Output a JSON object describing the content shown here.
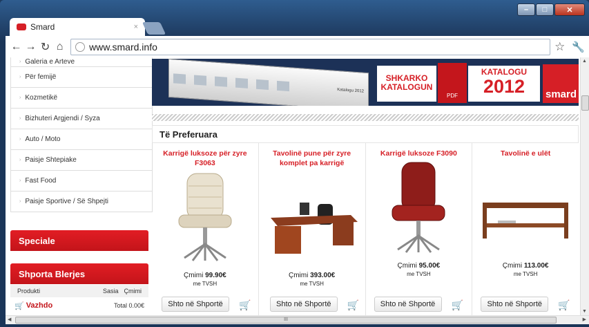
{
  "browser": {
    "tab_title": "Smard",
    "tab_close": "×",
    "url": "www.smard.info",
    "win_minimize": "–",
    "win_maximize": "□",
    "win_close": "✕",
    "scroll_grip": "III"
  },
  "sidebar": {
    "categories": [
      "Galeria e Arteve",
      "Për femijë",
      "Kozmetikë",
      "Bizhuteri Argjendi / Syza",
      "Auto / Moto",
      "Paisje Shtepiake",
      "Fast Food",
      "Paisje Sportive / Së Shpejti"
    ],
    "speciale": "Speciale",
    "cart_title": "Shporta Blerjes",
    "col_product": "Produkti",
    "col_qty": "Sasia",
    "col_price": "Çmimi",
    "continue": "Vazhdo",
    "total_label": "Total",
    "total_value": "0.00€"
  },
  "banner": {
    "download_line1": "SHKARKO",
    "download_line2": "KATALOGUN",
    "pdf": "PDF",
    "catalog_word": "KATALOGU",
    "year": "2012",
    "logo": "smard",
    "strip_label": "Katalogu 2012"
  },
  "section": {
    "title": "Të Preferuara"
  },
  "products": [
    {
      "name": "Karrigë luksoze për zyre F3063",
      "price_label": "Çmimi",
      "price": "99.90€",
      "tax": "me TVSH",
      "button": "Shto në Shportë"
    },
    {
      "name": "Tavolinë pune për zyre komplet pa karrigë",
      "price_label": "Çmimi",
      "price": "393.00€",
      "tax": "me TVSH",
      "button": "Shto në Shportë"
    },
    {
      "name": "Karrigë luksoze F3090",
      "price_label": "Çmimi",
      "price": "95.00€",
      "tax": "me TVSH",
      "button": "Shto në Shportë"
    },
    {
      "name": "Tavolinë e ulët",
      "price_label": "Çmimi",
      "price": "113.00€",
      "tax": "me TVSH",
      "button": "Shto në Shportë"
    }
  ],
  "colors": {
    "brand_red": "#d61f26",
    "banner_navy": "#1c3157"
  }
}
